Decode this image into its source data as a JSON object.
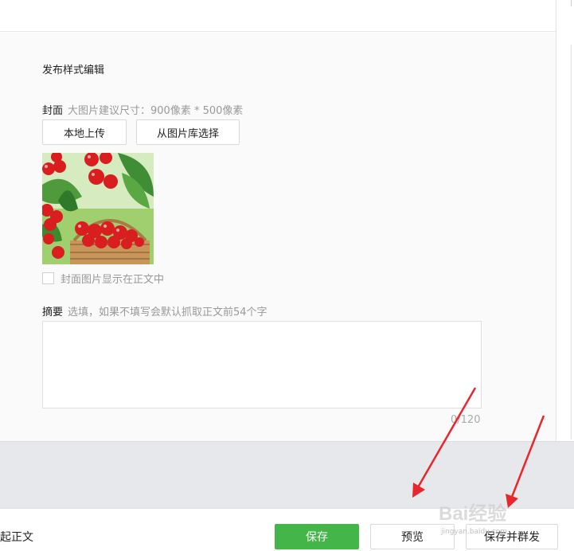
{
  "editor": {
    "section_title": "发布样式编辑",
    "cover": {
      "label": "封面",
      "hint": "大图片建议尺寸：900像素 * 500像素",
      "upload_button": "本地上传",
      "library_button": "从图片库选择",
      "image_alt": "cherries in basket",
      "show_in_body_label": "封面图片显示在正文中",
      "show_in_body_checked": false
    },
    "summary": {
      "label": "摘要",
      "hint": "选填，如果不填写会默认抓取正文前54个字",
      "value": "",
      "counter": "0/120"
    }
  },
  "footer": {
    "left_text": "起正文",
    "save": "保存",
    "preview": "预览",
    "save_and_send": "保存并群发"
  },
  "colors": {
    "accent_green": "#44b549",
    "annotation_red": "#e8262c"
  },
  "watermark": {
    "brand": "Bai经验",
    "url": "jingyan.baidu.com"
  }
}
